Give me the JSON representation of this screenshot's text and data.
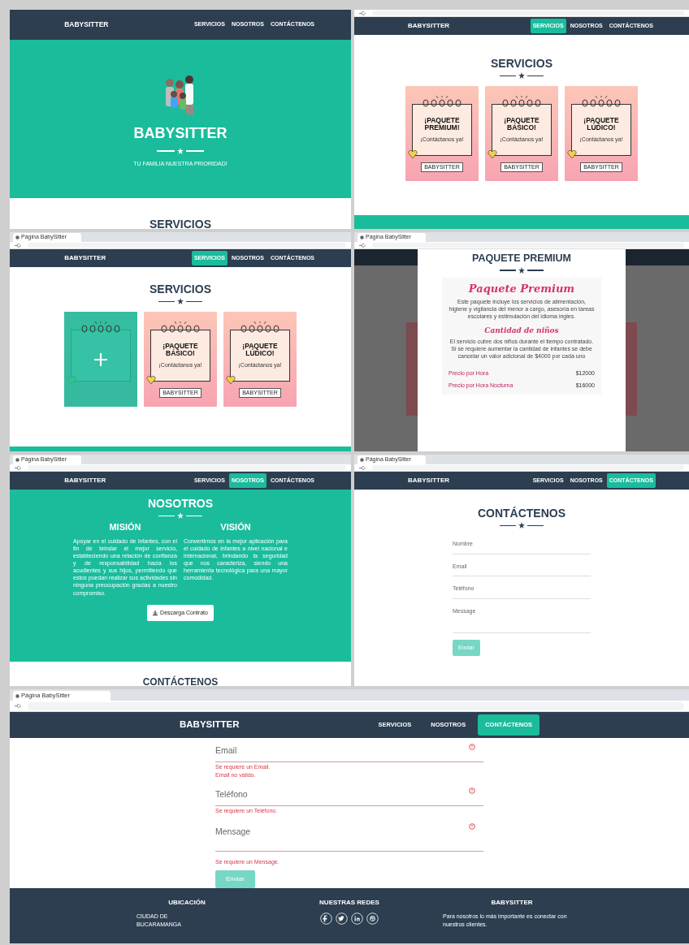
{
  "screens": [
    {
      "kind": "hero",
      "browser_tabs": false,
      "address_bar": false,
      "navbar": {
        "brand": "BABYSITTER",
        "links": [
          {
            "label": "SERVICIOS",
            "selected": false
          },
          {
            "label": "NOSOTROS",
            "selected": false
          },
          {
            "label": "CONTÁCTENOS",
            "selected": false
          }
        ]
      },
      "title": "BABYSITTER",
      "subtitle": "TU FAMILIA NUESTRA PRIORIDAD!",
      "next_heading": "SERVICIOS"
    },
    {
      "kind": "services",
      "browser_tabs": false,
      "address_bar": true,
      "navbar": {
        "brand": "BABYSITTER",
        "links": [
          {
            "label": "SERVICIOS",
            "selected": true
          },
          {
            "label": "NOSOTROS",
            "selected": false
          },
          {
            "label": "CONTÁCTENOS",
            "selected": false
          }
        ]
      },
      "heading": "SERVICIOS",
      "cards": [
        {
          "title": "¡PAQUETE PREMIUM!",
          "text": "¡Contáctanos ya!",
          "button": "BABYSITTER",
          "hovered": false
        },
        {
          "title": "¡PAQUETE BÁSICO!",
          "text": "¡Contáctanos ya!",
          "button": "BABYSITTER",
          "hovered": false
        },
        {
          "title": "¡PAQUETE LÚDICO!",
          "text": "¡Contáctanos ya!",
          "button": "BABYSITTER",
          "hovered": false
        }
      ]
    },
    {
      "kind": "services",
      "browser_tabs": true,
      "address_bar": true,
      "tab_title": "Página BabySitter",
      "navbar": {
        "brand": "BABYSITTER",
        "links": [
          {
            "label": "SERVICIOS",
            "selected": true
          },
          {
            "label": "NOSOTROS",
            "selected": false
          },
          {
            "label": "CONTÁCTENOS",
            "selected": false
          }
        ]
      },
      "heading": "SERVICIOS",
      "cards": [
        {
          "hovered": true
        },
        {
          "title": "¡PAQUETE BÁSICO!",
          "text": "¡Contáctanos ya!",
          "button": "BABYSITTER",
          "hovered": false
        },
        {
          "title": "¡PAQUETE LÚDICO!",
          "text": "¡Contáctanos ya!",
          "button": "BABYSITTER",
          "hovered": false
        }
      ]
    },
    {
      "kind": "modal",
      "browser_tabs": true,
      "address_bar": true,
      "tab_title": "Página BabySitter",
      "modal": {
        "heading": "PAQUETE PREMIUM",
        "title": "Paquete Premium",
        "description": "Este paquete incluye los servicios de alimentación, higiene y vigilancia del menor a cargo, asesoría en tareas escolares y estimulación del idioma ingles.",
        "subtitle": "Cantidad de niños",
        "details": "El servicio cubre dos niños durante el tiempo contratado. Si se requiere aumentar la cantidad de infantes se debe cancelar un valor  adicional de $4000 por cada uno",
        "prices": [
          {
            "label": "Precio por Hora",
            "value": "$12000"
          },
          {
            "label": "Precio por Hora Nocturna",
            "value": "$16000"
          }
        ]
      }
    },
    {
      "kind": "about",
      "browser_tabs": true,
      "address_bar": true,
      "tab_title": "Página BabySitter",
      "navbar": {
        "brand": "BABYSITTER",
        "links": [
          {
            "label": "SERVICIOS",
            "selected": false
          },
          {
            "label": "NOSOTROS",
            "selected": true
          },
          {
            "label": "CONTÁCTENOS",
            "selected": false
          }
        ]
      },
      "heading": "NOSOTROS",
      "columns": [
        {
          "title": "MISIÓN",
          "text": "Apoyar en el cuidado de infantes, con el fin de brindar el mejor servicio, estableciendo una relación de confianza y de responsabilidad hacia los acudientes y sus hijos, permitiendo que estos puedan realizar sus actividades sin ninguna preocupación gracias a nuestro compromiso."
        },
        {
          "title": "VISIÓN",
          "text": "Convertirnos en la mejor aplicación para el cuidado de infantes a nivel nacional e internacional, brindando la seguridad que nos caracteriza, siendo una herramienta tecnológica para una mayor comodidad."
        }
      ],
      "button": "Descarga Contrato",
      "next_heading": "CONTÁCTENOS"
    },
    {
      "kind": "contact",
      "browser_tabs": true,
      "address_bar": true,
      "tab_title": "Página BabySitter",
      "navbar": {
        "brand": "BABYSITTER",
        "links": [
          {
            "label": "SERVICIOS",
            "selected": false
          },
          {
            "label": "NOSOTROS",
            "selected": false
          },
          {
            "label": "CONTÁCTENOS",
            "selected": true
          }
        ]
      },
      "heading": "CONTÁCTENOS",
      "fields": [
        {
          "kind": "input",
          "placeholder": "Nombre",
          "invalid": false
        },
        {
          "kind": "input",
          "placeholder": "Email",
          "invalid": false
        },
        {
          "kind": "input",
          "placeholder": "Teléfono",
          "invalid": false
        },
        {
          "kind": "textarea",
          "placeholder": "Message",
          "invalid": false
        }
      ],
      "button": "Enviar"
    },
    {
      "kind": "contact_errors",
      "browser_tabs": true,
      "address_bar": true,
      "tab_title": "Página BabySitter",
      "navbar": {
        "brand": "BABYSITTER",
        "links": [
          {
            "label": "SERVICIOS",
            "selected": false
          },
          {
            "label": "NOSOTROS",
            "selected": false
          },
          {
            "label": "CONTÁCTENOS",
            "selected": true
          }
        ]
      },
      "fields": [
        {
          "kind": "input",
          "placeholder": "Email",
          "invalid": true,
          "errors": [
            "Se requiere un Email.",
            "Email no valido."
          ]
        },
        {
          "kind": "input",
          "placeholder": "Teléfono",
          "invalid": true,
          "errors": [
            "Se requiere un Teléfono."
          ]
        },
        {
          "kind": "textarea",
          "placeholder": "Mensage",
          "invalid": true,
          "errors": [
            "Se requiere un Mensage."
          ]
        }
      ],
      "button": "Enviar",
      "footer": {
        "columns": [
          {
            "kind": "text",
            "title": "UBICACIÓN",
            "text": "CIUDAD DE BUCARAMANGA"
          },
          {
            "kind": "social",
            "title": "NUESTRAS REDES",
            "networks": [
              {
                "kind": "facebook"
              },
              {
                "kind": "twitter"
              },
              {
                "kind": "linkedin"
              },
              {
                "kind": "dribbble"
              }
            ]
          },
          {
            "kind": "text",
            "title": "BABYSITTER",
            "text": "Para nosotros lo más importante es conectar con nuestros clientes."
          }
        ]
      }
    }
  ]
}
